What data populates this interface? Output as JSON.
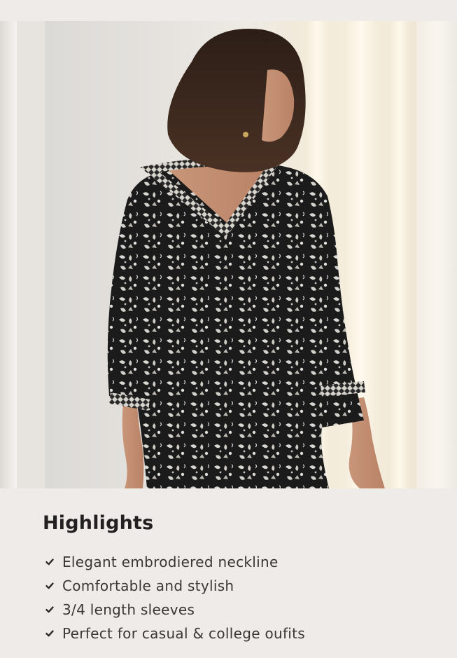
{
  "highlights": {
    "title": "Highlights",
    "items": [
      {
        "text": "Elegant embrodiered neckline",
        "icon": "check-icon"
      },
      {
        "text": "Comfortable and stylish",
        "icon": "check-icon"
      },
      {
        "text": "3/4 length sleeves",
        "icon": "check-icon"
      },
      {
        "text": "Perfect for casual & college oufits",
        "icon": "check-icon"
      }
    ]
  },
  "colors": {
    "background": "#efebe8",
    "title": "#222020",
    "body_text": "#3a3634",
    "garment": "#1e1d1d",
    "print": "#dcdad4"
  }
}
